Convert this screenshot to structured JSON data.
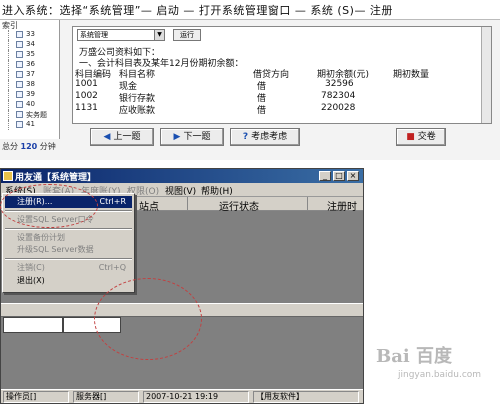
{
  "header": {
    "instruction": "进入系统：选择“系统管理”— 启动 — 打开系统管理窗口 — 系统 (S)— 注册"
  },
  "exam": {
    "sidebar_title": "索引",
    "question_numbers": [
      "33",
      "34",
      "35",
      "36",
      "37",
      "38",
      "39",
      "40",
      "实务题",
      "41"
    ],
    "score_label": "总分",
    "score_value": "120",
    "score_unit": "分钟",
    "select_value": "系统管理",
    "run_button": "运行",
    "lines": [
      "万盛公司资料如下：",
      "一、会计科目表及某年12月份期初余额："
    ],
    "table_headers": [
      "科目编码",
      "科目名称",
      "借贷方向",
      "期初余额(元)",
      "期初数量"
    ],
    "table_rows": [
      [
        "1001",
        "现金",
        "借",
        "32596",
        ""
      ],
      [
        "1002",
        "银行存款",
        "借",
        "782304",
        ""
      ],
      [
        "1131",
        "应收账款",
        "借",
        "220028",
        ""
      ]
    ],
    "buttons": {
      "prev": "上一题",
      "next": "下一题",
      "help": "考虑考虑",
      "submit": "交卷"
    }
  },
  "window": {
    "title": "用友通【系统管理】",
    "controls": [
      "_",
      "□",
      "×"
    ],
    "menus": [
      {
        "label": "系统(S)",
        "disabled": false
      },
      {
        "label": "账套(A)",
        "disabled": true
      },
      {
        "label": "年度账(Y)",
        "disabled": true
      },
      {
        "label": "权限(O)",
        "disabled": true
      },
      {
        "label": "视图(V)",
        "disabled": false
      },
      {
        "label": "帮助(H)",
        "disabled": false
      }
    ],
    "columns": [
      "站点",
      "运行状态",
      "注册时"
    ],
    "status": [
      "操作员[]",
      "服务器[]",
      "2007-10-21 19:19",
      "【用友软件】"
    ]
  },
  "dropdown": {
    "items": [
      {
        "label": "注册(R)...",
        "shortcut": "Ctrl+R",
        "disabled": false,
        "selected": true
      },
      {
        "label": "设置SQL Server口令",
        "shortcut": "",
        "disabled": true
      },
      {
        "label": "设置备份计划",
        "shortcut": "",
        "disabled": true
      },
      {
        "label": "升级SQL Server数据",
        "shortcut": "",
        "disabled": true
      },
      {
        "label": "注销(C)",
        "shortcut": "Ctrl+Q",
        "disabled": true
      },
      {
        "label": "退出(X)",
        "shortcut": "",
        "disabled": false
      }
    ]
  },
  "watermark": {
    "logo": "Bai 百度",
    "subtitle": "jingyan.baidu.com"
  }
}
